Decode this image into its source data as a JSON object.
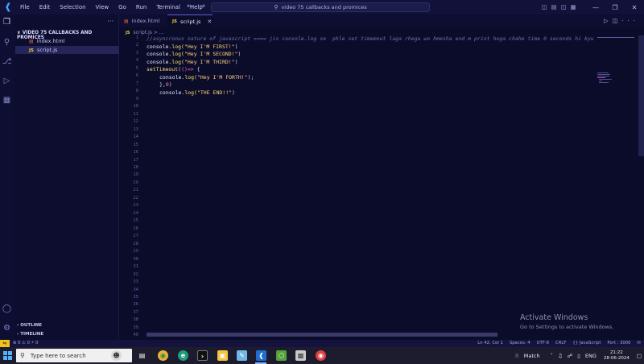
{
  "titlebar": {
    "logo": "vscode-logo",
    "menu": [
      "File",
      "Edit",
      "Selection",
      "View",
      "Go",
      "Run",
      "Terminal",
      "Help"
    ],
    "search": "video 75 callbacks and promices"
  },
  "explorer": {
    "folder": "VIDEO 75 CALLBACKS AND PROMICES",
    "files": [
      {
        "name": "index.html",
        "icon": "html-icon"
      },
      {
        "name": "script.js",
        "icon": "js-icon",
        "active": true
      }
    ],
    "outline": "OUTLINE",
    "timeline": "TIMELINE"
  },
  "tabs": [
    {
      "label": "index.html",
      "icon_text": "▤"
    },
    {
      "label": "script.js",
      "icon_text": "JS",
      "active": true
    }
  ],
  "breadcrumb": {
    "icon_text": "JS",
    "file": "script.js",
    "rest": "> ..."
  },
  "editor": {
    "line_numbers": [
      "1",
      "2",
      "3",
      "4",
      "5",
      "6",
      "7",
      "8",
      "9",
      "10",
      "11",
      "12",
      "13",
      "14",
      "15",
      "16",
      "17",
      "18",
      "19",
      "20",
      "21",
      "22",
      "23",
      "24",
      "25",
      "26",
      "27",
      "28",
      "29",
      "30",
      "31",
      "32",
      "33",
      "34",
      "35",
      "36",
      "37",
      "38",
      "39",
      "40"
    ],
    "lines": {
      "l1": "//asyncronus nature of javascript ==== jis console.log se  phle set timemout laga rhega wo hmesha end m print hoga chahe time 0 seconds hi kyu",
      "l2_fn": "console",
      "l2_m": ".log(",
      "l2_s": "\"Hey I'M FIRST!\"",
      "l2_e": ")",
      "l3_fn": "console",
      "l3_m": ".log(",
      "l3_s": "\"Hey I'M SECOND!\"",
      "l3_e": ")",
      "l4_fn": "console",
      "l4_m": ".log(",
      "l4_s": "\"Hey I'M THIRD!\"",
      "l4_e": ")",
      "l5_fn": "setTimeout",
      "l5_p": "(",
      "l5_a": "()=>",
      "l5_b": " {",
      "l6_fn": "console",
      "l6_m": ".log(",
      "l6_s": "\"Hey I'M FORTH!\"",
      "l6_e": ");",
      "l7_p": "},",
      "l7_n": "0",
      "l7_e": ")",
      "l8_fn": "console",
      "l8_m": ".log(",
      "l8_s": "\"THE END!!\"",
      "l8_e": ")"
    }
  },
  "watermark": {
    "title": "Activate Windows",
    "subtitle": "Go to Settings to activate Windows."
  },
  "statusbar": {
    "left": "⊗ 0 ⚠ 0   ⚡ 0",
    "position": "Ln 42, Col 1",
    "spaces": "Spaces: 4",
    "encoding": "UTF-8",
    "eol": "CRLF",
    "language": "{} JavaScript",
    "port": "Port : 3000"
  },
  "taskbar": {
    "search_placeholder": "Type here to search",
    "weather": "Match",
    "lang": "ENG",
    "time": "21:22",
    "date": "28-06-2024"
  },
  "colors": {
    "accent": "#5a5fd0",
    "remote": "#f2c21a",
    "string": "#ffd27a",
    "keyword": "#ff5fd3"
  }
}
